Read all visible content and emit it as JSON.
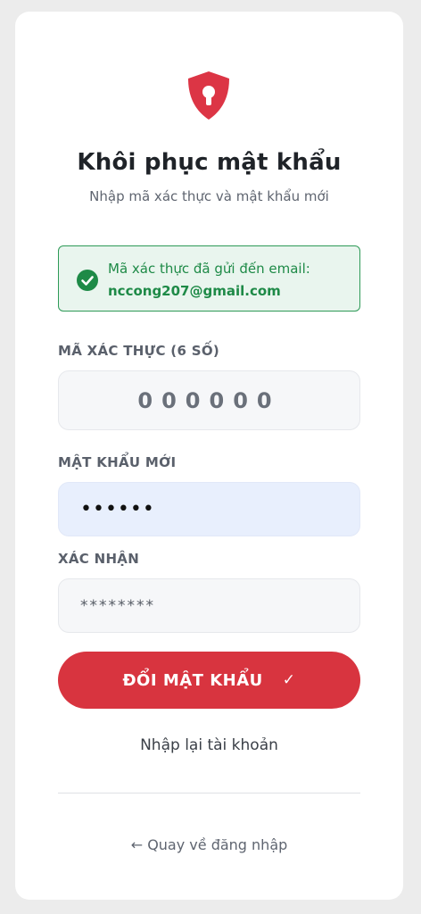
{
  "header": {
    "title": "Khôi phục mật khẩu",
    "subtitle": "Nhập mã xác thực và mật khẩu mới",
    "logo_icon": "shield-keyhole-icon",
    "brand_color": "#dc3545"
  },
  "alert": {
    "icon": "check-circle-icon",
    "message": "Mã xác thực đã gửi đến email:",
    "email": "nccong207@gmail.com",
    "color": "#1e8a47"
  },
  "form": {
    "otp": {
      "label": "MÃ XÁC THỰC (6 SỐ)",
      "placeholder": "000000",
      "value": ""
    },
    "new_password": {
      "label": "MẬT KHẨU MỚI",
      "value": "••••••"
    },
    "confirm_password": {
      "label": "XÁC NHẬN",
      "placeholder": "********",
      "value": ""
    },
    "submit": {
      "label": "ĐỔI MẬT KHẨU",
      "icon": "check-icon",
      "icon_glyph": "✓"
    }
  },
  "links": {
    "reenter_account": "Nhập lại tài khoản",
    "back_to_login": "← Quay về đăng nhập"
  }
}
